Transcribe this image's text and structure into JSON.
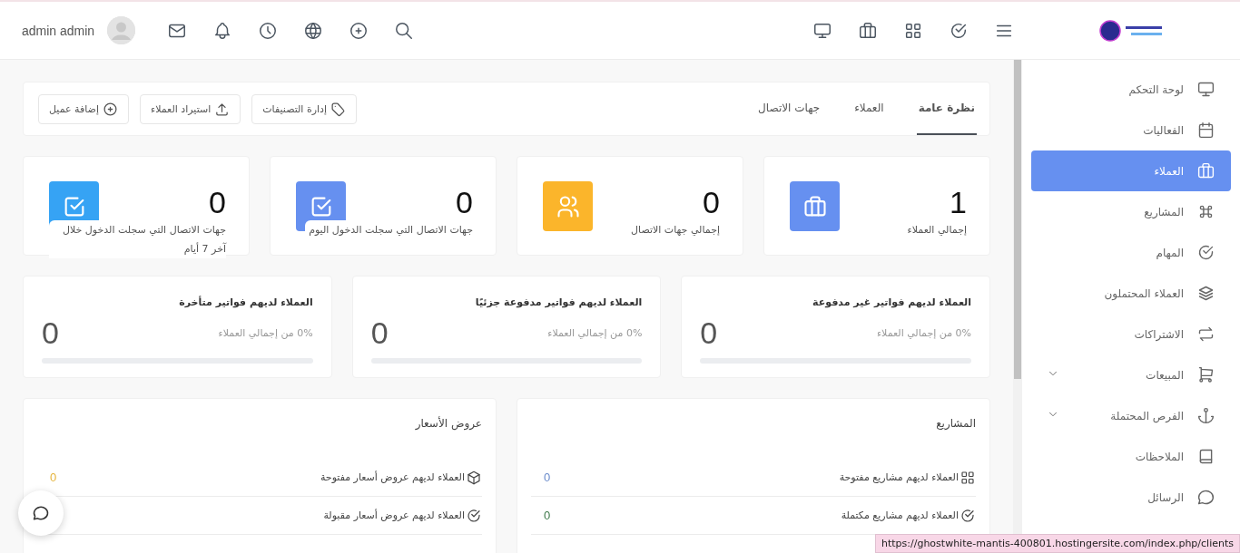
{
  "header": {
    "user_name": "admin admin"
  },
  "sidebar": {
    "items": [
      {
        "label": "لوحة التحكم",
        "selected": false,
        "has_submenu": false
      },
      {
        "label": "الفعاليات",
        "selected": false,
        "has_submenu": false
      },
      {
        "label": "العملاء",
        "selected": true,
        "has_submenu": false
      },
      {
        "label": "المشاريع",
        "selected": false,
        "has_submenu": false
      },
      {
        "label": "المهام",
        "selected": false,
        "has_submenu": false
      },
      {
        "label": "العملاء المحتملون",
        "selected": false,
        "has_submenu": false
      },
      {
        "label": "الاشتراكات",
        "selected": false,
        "has_submenu": false
      },
      {
        "label": "المبيعات",
        "selected": false,
        "has_submenu": true
      },
      {
        "label": "الفرص المحتملة",
        "selected": false,
        "has_submenu": true
      },
      {
        "label": "الملاحظات",
        "selected": false,
        "has_submenu": false
      },
      {
        "label": "الرسائل",
        "selected": false,
        "has_submenu": false
      }
    ]
  },
  "tabs": [
    {
      "label": "نظرة عامة",
      "selected": true
    },
    {
      "label": "العملاء",
      "selected": false
    },
    {
      "label": "جهات الاتصال",
      "selected": false
    }
  ],
  "toolbar_buttons": [
    {
      "label": "إدارة التصنيفات"
    },
    {
      "label": "استيراد العملاء"
    },
    {
      "label": "إضافة عميل"
    }
  ],
  "stat_cards": [
    {
      "value": "1",
      "label": "إجمالي العملاء",
      "color": "#6690f0"
    },
    {
      "value": "0",
      "label": "إجمالي جهات الاتصال",
      "color": "#fbb52b"
    },
    {
      "value": "0",
      "label": "جهات الاتصال التي سجلت الدخول اليوم",
      "color": "#6690f0"
    },
    {
      "value": "0",
      "label": "جهات الاتصال التي سجلت الدخول خلال آخر 7 أيام",
      "color": "#36a3f4"
    }
  ],
  "invoice_cards": [
    {
      "title": "العملاء لديهم فواتير غير مدفوعة",
      "percent": "0% من إجمالي العملاء",
      "value": "0"
    },
    {
      "title": "العملاء لديهم فواتير مدفوعة جزئيًا",
      "percent": "0% من إجمالي العملاء",
      "value": "0"
    },
    {
      "title": "العملاء لديهم فواتير متأخرة",
      "percent": "0% من إجمالي العملاء",
      "value": "0"
    }
  ],
  "panels": [
    {
      "title": "المشاريع",
      "rows": [
        {
          "label": "العملاء لديهم مشاريع مفتوحة",
          "value": "0",
          "color": "#6b8ccc"
        },
        {
          "label": "العملاء لديهم مشاريع مكتملة",
          "value": "0",
          "color": "#3f7a4c"
        }
      ]
    },
    {
      "title": "عروض الأسعار",
      "rows": [
        {
          "label": "العملاء لديهم عروض أسعار مفتوحة",
          "value": "0",
          "color": "#e5b43c"
        },
        {
          "label": "العملاء لديهم عروض أسعار مقبولة"
        }
      ]
    }
  ],
  "status_bar": {
    "url": "https://ghostwhite-mantis-400801.hostingersite.com/index.php/clients"
  }
}
